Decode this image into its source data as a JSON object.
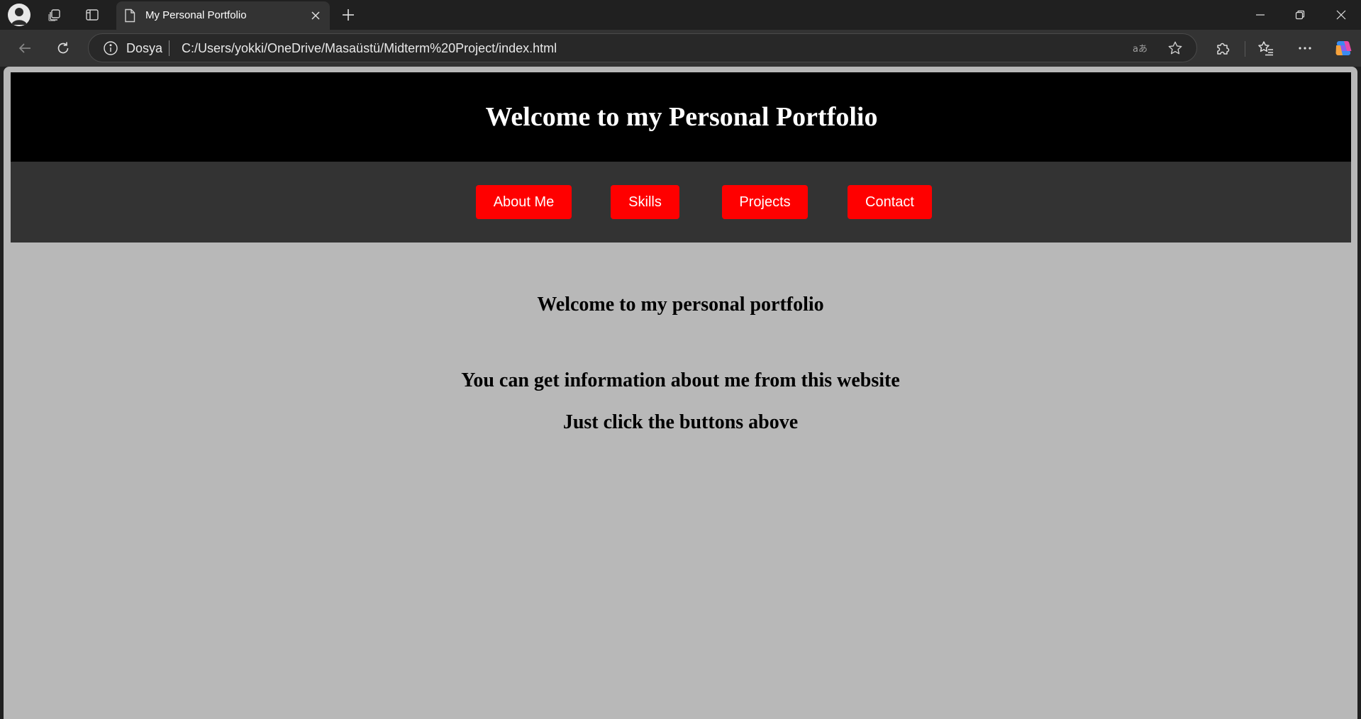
{
  "browser": {
    "tab": {
      "title": "My Personal Portfolio"
    },
    "address_bar": {
      "site_label": "Dosya",
      "url": "C:/Users/yokki/OneDrive/Masaüstü/Midterm%20Project/index.html"
    },
    "icons": {
      "profile": "avatar-icon",
      "workspaces": "workspaces-icon",
      "tab_actions": "vertical-tabs-icon",
      "page": "page-icon",
      "close_tab": "close-icon",
      "new_tab": "plus-icon",
      "minimize": "minimize-icon",
      "restore": "restore-icon",
      "close_window": "close-icon",
      "back": "back-arrow-icon",
      "refresh": "refresh-icon",
      "info": "info-icon",
      "read_aloud": "read-aloud-icon",
      "favorite": "star-icon",
      "extensions": "puzzle-icon",
      "favorites": "favorites-icon",
      "more": "more-icon",
      "copilot": "copilot-icon"
    }
  },
  "page": {
    "header_title": "Welcome to my Personal Portfolio",
    "nav": [
      {
        "label": "About Me"
      },
      {
        "label": "Skills"
      },
      {
        "label": "Projects"
      },
      {
        "label": "Contact"
      }
    ],
    "main": {
      "heading": "Welcome to my personal portfolio",
      "line1": "You can get information about me from this website",
      "line2": "Just click the buttons above"
    }
  },
  "colors": {
    "header_bg": "#000000",
    "nav_bg": "#333333",
    "button_bg": "#ff0000",
    "page_bg": "#b8b8b8"
  }
}
